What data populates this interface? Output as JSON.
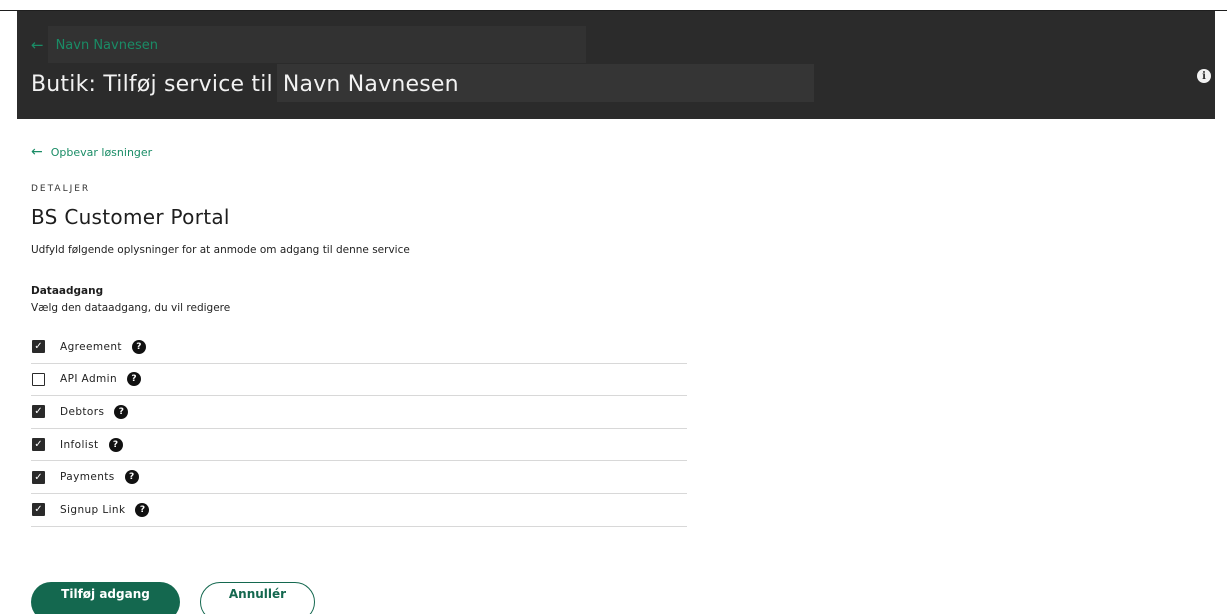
{
  "header": {
    "back_label": "Navn Navnesen",
    "title_prefix": "Butik: Tilføj service til",
    "title_name": "Navn Navnesen"
  },
  "back_link": {
    "label": "Opbevar løsninger"
  },
  "details": {
    "section_label": "DETALJER",
    "service_name": "BS Customer Portal",
    "description": "Udfyld følgende oplysninger for at anmode om adgang til denne service"
  },
  "data_access": {
    "label": "Dataadgang",
    "help": "Vælg den dataadgang, du vil redigere",
    "options": [
      {
        "label": "Agreement",
        "checked": true
      },
      {
        "label": "API Admin",
        "checked": false
      },
      {
        "label": "Debtors",
        "checked": true
      },
      {
        "label": "Infolist",
        "checked": true
      },
      {
        "label": "Payments",
        "checked": true
      },
      {
        "label": "Signup Link",
        "checked": true
      }
    ]
  },
  "actions": {
    "submit_label": "Tilføj adgang",
    "cancel_label": "Annullér"
  },
  "colors": {
    "accent": "#14684f",
    "link": "#1a8c66",
    "header_bg": "#2b2b2b"
  }
}
